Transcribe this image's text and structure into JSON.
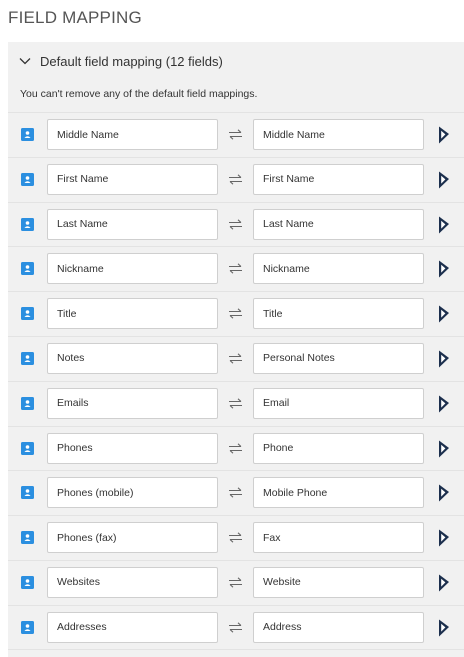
{
  "page_title": "FIELD MAPPING",
  "section": {
    "title": "Default field mapping (12 fields)",
    "expanded": true,
    "notice": "You can't remove any of the default field mappings."
  },
  "icons": {
    "section_toggle": "chevron-down-icon",
    "source": "contact-card-icon",
    "swap": "bidirectional-arrows-icon",
    "target": "dynamics-logo-icon"
  },
  "colors": {
    "source_icon": "#2b8fe0",
    "target_icon": "#1c2f4d",
    "panel_bg": "#f1f1f1"
  },
  "mappings": [
    {
      "source": "Middle Name",
      "target": "Middle Name"
    },
    {
      "source": "First Name",
      "target": "First Name"
    },
    {
      "source": "Last Name",
      "target": "Last Name"
    },
    {
      "source": "Nickname",
      "target": "Nickname"
    },
    {
      "source": "Title",
      "target": "Title"
    },
    {
      "source": "Notes",
      "target": "Personal Notes"
    },
    {
      "source": "Emails",
      "target": "Email"
    },
    {
      "source": "Phones",
      "target": "Phone"
    },
    {
      "source": "Phones (mobile)",
      "target": "Mobile Phone"
    },
    {
      "source": "Phones (fax)",
      "target": "Fax"
    },
    {
      "source": "Websites",
      "target": "Website"
    },
    {
      "source": "Addresses",
      "target": "Address"
    }
  ]
}
